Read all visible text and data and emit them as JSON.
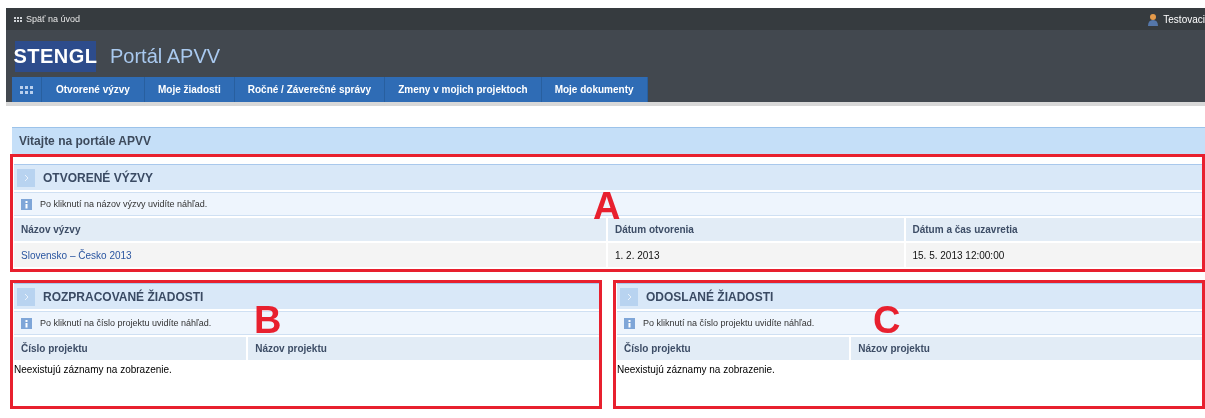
{
  "top_bar": {
    "back_link": "Späť na úvod",
    "user": "Testovaci"
  },
  "header": {
    "logo": "STENGL",
    "title": "Portál APVV"
  },
  "nav": {
    "items": [
      {
        "label": "Otvorené výzvy",
        "selected": false
      },
      {
        "label": "Moje žiadosti",
        "selected": false
      },
      {
        "label": "Ročné / Záverečné správy",
        "selected": false
      },
      {
        "label": "Zmeny v mojich projektoch",
        "selected": false
      },
      {
        "label": "Moje dokumenty",
        "selected": false
      }
    ]
  },
  "welcome": "Vitajte na portále APVV",
  "panel_rows": [
    [
      {
        "marker": "A",
        "title": "OTVORENÉ VÝZVY",
        "info": "Po kliknutí na názov výzvy uvidíte náhľad.",
        "columns": [
          "Názov výzvy",
          "Dátum otvorenia",
          "Dátum a čas uzavretia"
        ],
        "rows": [
          [
            {
              "kind": "link",
              "text": "Slovensko – Česko 2013"
            },
            {
              "kind": "text",
              "text": "1. 2. 2013"
            },
            {
              "kind": "text",
              "text": "15. 5. 2013 12:00:00"
            }
          ]
        ]
      }
    ],
    [
      {
        "marker": "B",
        "title": "ROZPRACOVANÉ ŽIADOSTI",
        "info": "Po kliknutí na číslo projektu uvidíte náhľad.",
        "columns": [
          "Číslo projektu",
          "Názov projektu"
        ],
        "empty_message": "Neexistujú záznamy na zobrazenie."
      },
      {
        "marker": "C",
        "title": "ODOSLANÉ ŽIADOSTI",
        "info": "Po kliknutí na číslo projektu uvidíte náhľad.",
        "columns": [
          "Číslo projektu",
          "Názov projektu"
        ],
        "empty_message": "Neexistujú záznamy na zobrazenie."
      }
    ]
  ]
}
